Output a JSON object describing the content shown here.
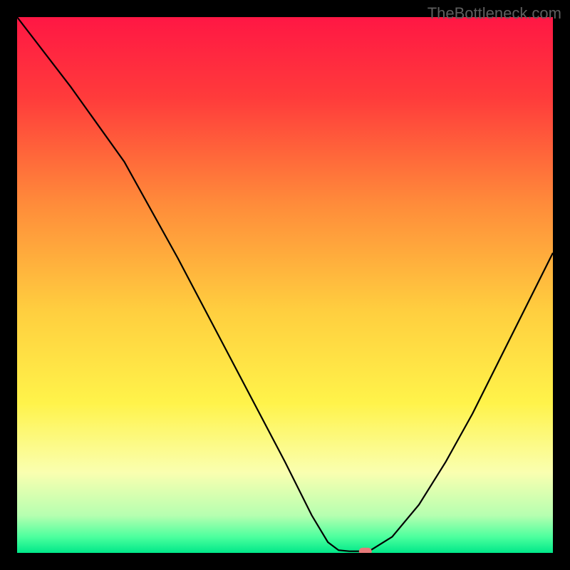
{
  "watermark": "TheBottleneck.com",
  "chart_data": {
    "type": "line",
    "title": "",
    "xlabel": "",
    "ylabel": "",
    "xlim": [
      0,
      100
    ],
    "ylim": [
      0,
      100
    ],
    "curve": [
      {
        "x": 0,
        "y": 100
      },
      {
        "x": 10,
        "y": 87
      },
      {
        "x": 20,
        "y": 73
      },
      {
        "x": 30,
        "y": 55
      },
      {
        "x": 40,
        "y": 36
      },
      {
        "x": 50,
        "y": 17
      },
      {
        "x": 55,
        "y": 7
      },
      {
        "x": 58,
        "y": 2
      },
      {
        "x": 60,
        "y": 0.5
      },
      {
        "x": 62,
        "y": 0.3
      },
      {
        "x": 64,
        "y": 0.3
      },
      {
        "x": 66,
        "y": 0.5
      },
      {
        "x": 70,
        "y": 3
      },
      {
        "x": 75,
        "y": 9
      },
      {
        "x": 80,
        "y": 17
      },
      {
        "x": 85,
        "y": 26
      },
      {
        "x": 90,
        "y": 36
      },
      {
        "x": 95,
        "y": 46
      },
      {
        "x": 100,
        "y": 56
      }
    ],
    "marker": {
      "x": 65,
      "y": 0.3
    },
    "gradient_stops": [
      {
        "offset": 0,
        "color": "#ff1744"
      },
      {
        "offset": 15,
        "color": "#ff3b3b"
      },
      {
        "offset": 35,
        "color": "#ff8c3a"
      },
      {
        "offset": 55,
        "color": "#ffcf3f"
      },
      {
        "offset": 72,
        "color": "#fff34a"
      },
      {
        "offset": 85,
        "color": "#faffb0"
      },
      {
        "offset": 93,
        "color": "#b6ffb0"
      },
      {
        "offset": 97,
        "color": "#4dff9e"
      },
      {
        "offset": 100,
        "color": "#00e889"
      }
    ]
  }
}
